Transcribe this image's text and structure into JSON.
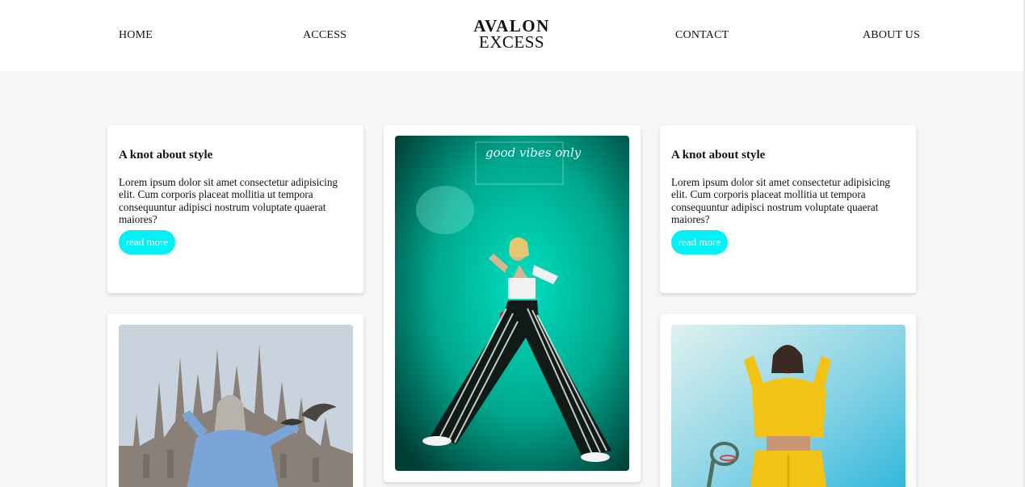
{
  "nav": {
    "home": "HOME",
    "access": "ACCESS",
    "contact": "CONTACT",
    "about": "ABOUT US"
  },
  "logo": {
    "line1": "AVALON",
    "line2": "EXCESS"
  },
  "cards": [
    {
      "title": "A knot about style",
      "text": "Lorem ipsum dolor sit amet consectetur adipisicing elit. Cum corporis placeat mollitia ut tempora consequuntur adipisci nostrum voluptate quaerat maiores?",
      "button": "read more"
    },
    {
      "title": "A knot about style",
      "text": "Lorem ipsum dolor sit amet consectetur adipisicing elit. Cum corporis placeat mollitia ut tempora consequuntur adipisci nostrum voluptate quaerat maiores?",
      "button": "read more"
    }
  ],
  "neon_sign": "good vibes only",
  "colors": {
    "accent": "#00f1f6",
    "background": "#f6f6f6",
    "header": "#ffffff"
  }
}
